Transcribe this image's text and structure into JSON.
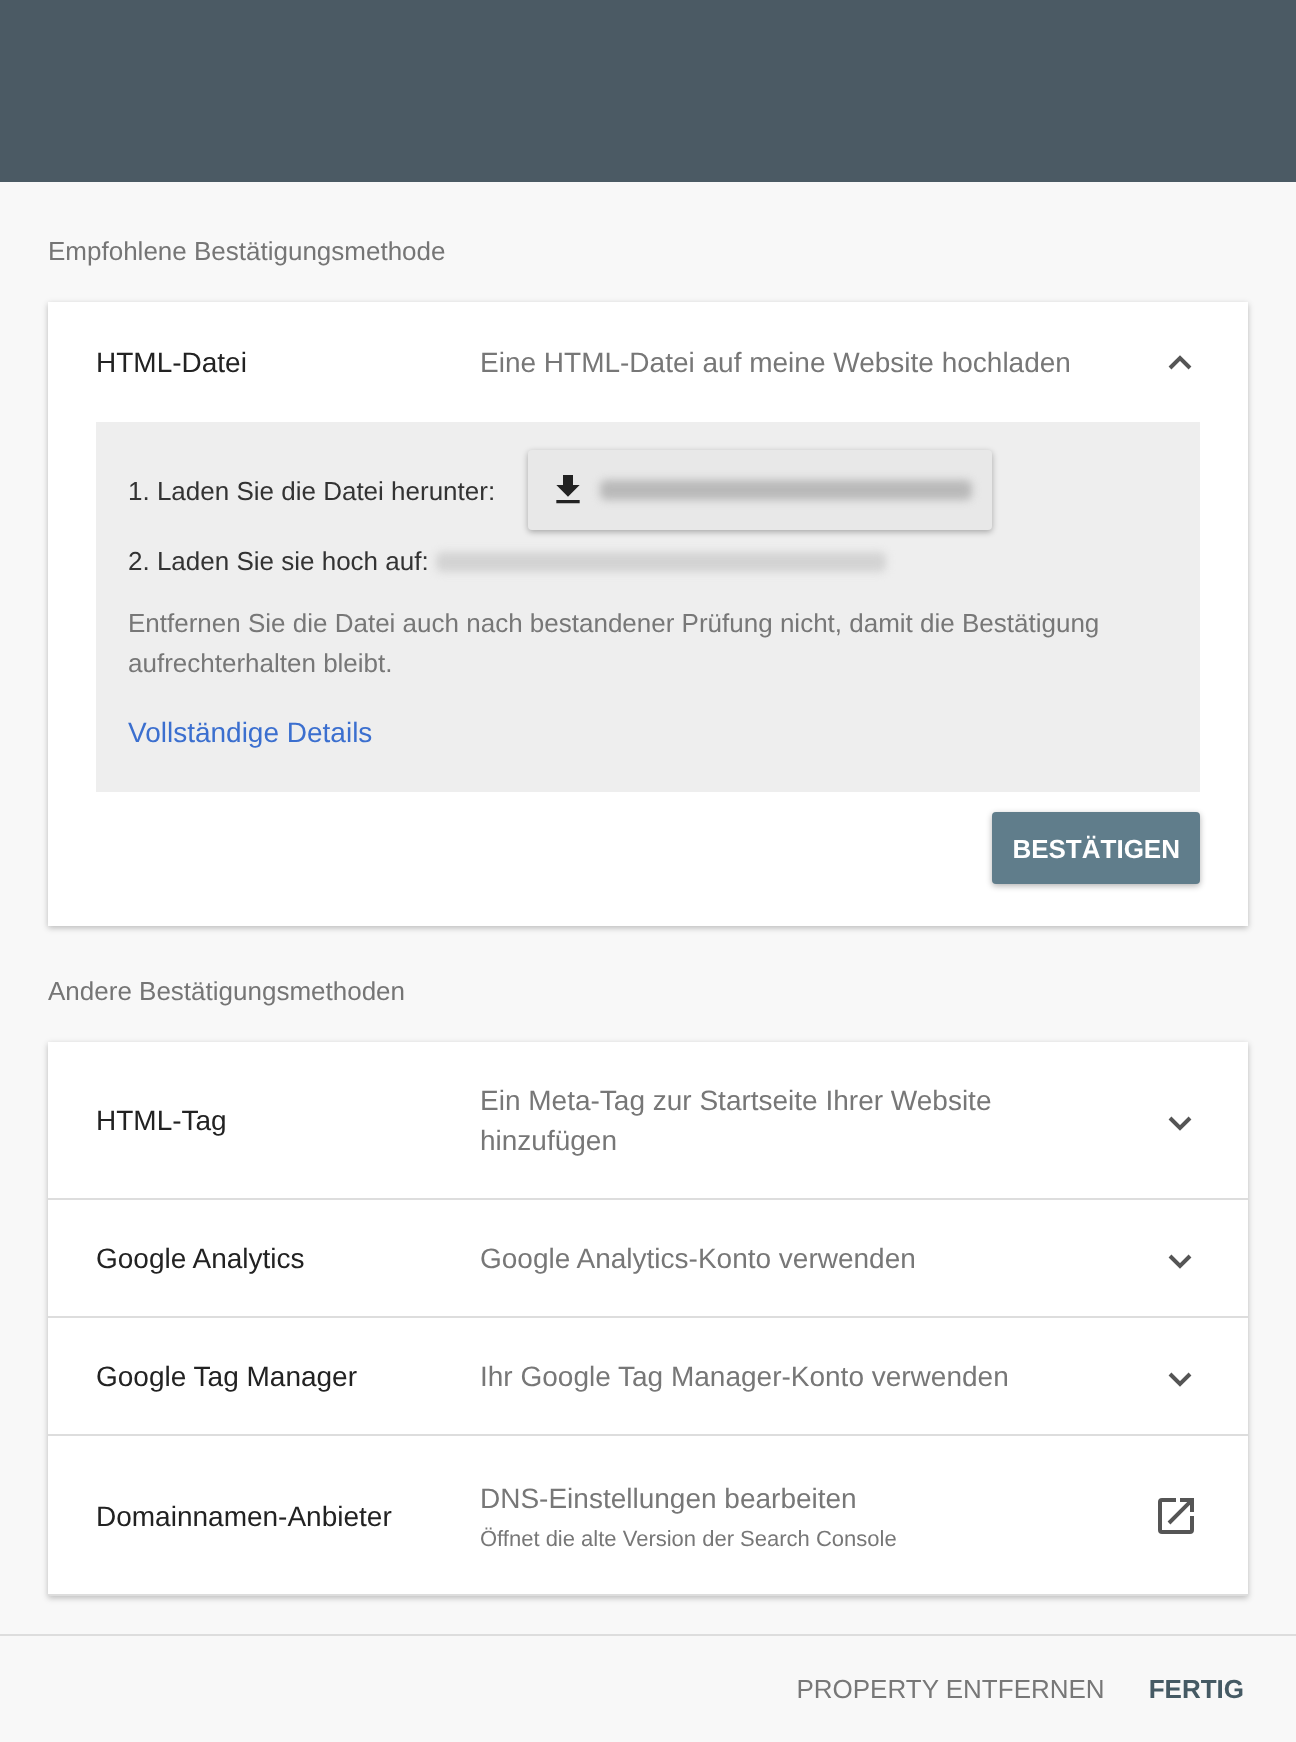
{
  "recommended": {
    "heading": "Empfohlene Bestätigungsmethode",
    "method": {
      "title": "HTML-Datei",
      "description": "Eine HTML-Datei auf meine Website hochladen",
      "expanded": true,
      "step_1": "1. Laden Sie die Datei herunter:",
      "step_2": "2. Laden Sie sie hoch auf:",
      "note": "Entfernen Sie die Datei auch nach bestandener Prüfung nicht, damit die Bestätigung aufrechterhalten bleibt.",
      "details_link": "Vollständige Details",
      "confirm_button": "BESTÄTIGEN"
    }
  },
  "other": {
    "heading": "Andere Bestätigungsmethoden",
    "methods": [
      {
        "kind": "expand",
        "title": "HTML-Tag",
        "description": "Ein Meta-Tag zur Startseite Ihrer Website hinzufügen",
        "expanded": false
      },
      {
        "kind": "expand",
        "title": "Google Analytics",
        "description": "Google Analytics-Konto verwenden",
        "expanded": false
      },
      {
        "kind": "expand",
        "title": "Google Tag Manager",
        "description": "Ihr Google Tag Manager-Konto verwenden",
        "expanded": false
      },
      {
        "kind": "external",
        "title": "Domainnamen-Anbieter",
        "description": "DNS-Einstellungen bearbeiten",
        "subtext": "Öffnet die alte Version der Search Console"
      }
    ]
  },
  "footer": {
    "buttons": [
      {
        "label": "PROPERTY ENTFERNEN",
        "primary": false
      },
      {
        "label": "FERTIG",
        "primary": true
      }
    ]
  }
}
